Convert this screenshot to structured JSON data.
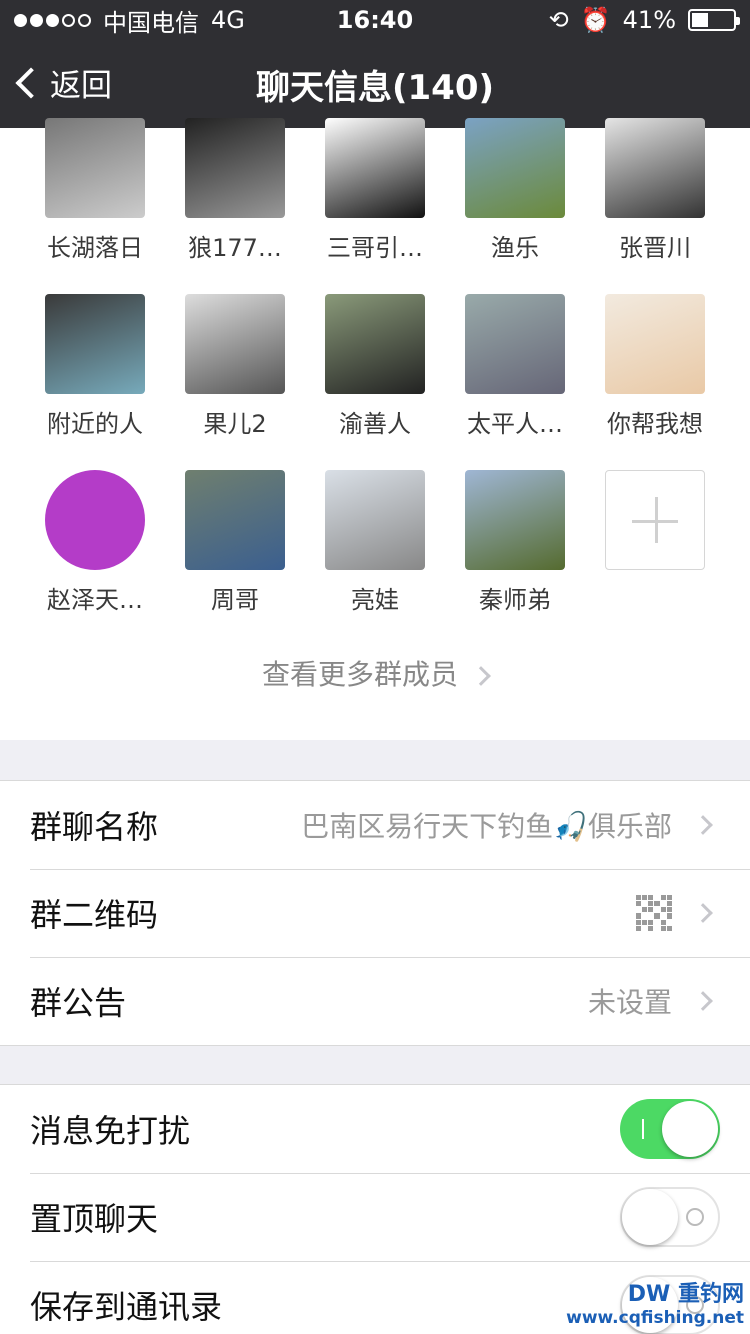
{
  "status_bar": {
    "carrier": "中国电信",
    "network": "4G",
    "time": "16:40",
    "battery_percent": "41%",
    "battery_level": 0.41
  },
  "nav": {
    "back_label": "返回",
    "title": "聊天信息(140)"
  },
  "members": [
    {
      "name": "长湖落日",
      "colors": [
        "#777",
        "#ccc"
      ]
    },
    {
      "name": "狼177…",
      "colors": [
        "#222",
        "#999"
      ]
    },
    {
      "name": "三哥引…",
      "colors": [
        "#fff",
        "#111"
      ]
    },
    {
      "name": "渔乐",
      "colors": [
        "#7ba2c4",
        "#6b8a3a"
      ]
    },
    {
      "name": "张晋川",
      "colors": [
        "#e5e5e5",
        "#333"
      ]
    },
    {
      "name": "附近的人",
      "colors": [
        "#3a3a3a",
        "#7ab"
      ]
    },
    {
      "name": "果儿2",
      "colors": [
        "#ddd",
        "#555"
      ]
    },
    {
      "name": "渝善人",
      "colors": [
        "#8a9a7a",
        "#222"
      ]
    },
    {
      "name": "太平人…",
      "colors": [
        "#9aa",
        "#667"
      ]
    },
    {
      "name": "你帮我想",
      "colors": [
        "#f2eadf",
        "#e9c9a6"
      ]
    },
    {
      "name": "赵泽天…",
      "colors": [
        "#b43cc8",
        "#b43cc8"
      ]
    },
    {
      "name": "周哥",
      "colors": [
        "#6f7f6f",
        "#3b5f8f"
      ]
    },
    {
      "name": "亮娃",
      "colors": [
        "#d9dfe6",
        "#888"
      ]
    },
    {
      "name": "秦师弟",
      "colors": [
        "#9fb6d4",
        "#556b2f"
      ]
    }
  ],
  "more_members_label": "查看更多群成员",
  "group_settings": [
    {
      "label": "群聊名称",
      "value": "巴南区易行天下钓鱼🎣俱乐部",
      "type": "text"
    },
    {
      "label": "群二维码",
      "value": "",
      "type": "qr"
    },
    {
      "label": "群公告",
      "value": "未设置",
      "type": "text"
    }
  ],
  "toggles": [
    {
      "label": "消息免打扰",
      "on": true
    },
    {
      "label": "置顶聊天",
      "on": false
    },
    {
      "label": "保存到通讯录",
      "on": false
    }
  ],
  "watermark": {
    "logo": "DW 重钓网",
    "url": "www.cqfishing.net"
  },
  "colors": {
    "nav_bg": "#2f2f33",
    "toggle_on": "#4cd964",
    "page_bg": "#efeff4"
  }
}
